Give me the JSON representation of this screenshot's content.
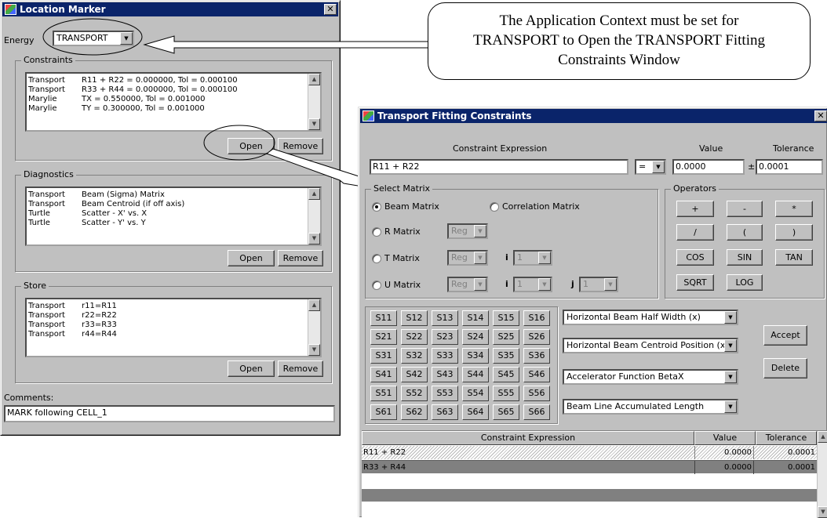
{
  "location_marker": {
    "title": "Location Marker",
    "close": "✕",
    "energy_label": "Energy",
    "energy_value": "TRANSPORT",
    "constraints": {
      "label": "Constraints",
      "rows": [
        {
          "code": "Transport",
          "text": "R11 + R22 = 0.000000, Tol = 0.000100"
        },
        {
          "code": "Transport",
          "text": "R33 + R44 = 0.000000, Tol = 0.000100"
        },
        {
          "code": "Marylie",
          "text": "TX = 0.550000, Tol = 0.001000"
        },
        {
          "code": "Marylie",
          "text": "TY = 0.300000, Tol = 0.001000"
        }
      ]
    },
    "diagnostics": {
      "label": "Diagnostics",
      "rows": [
        {
          "code": "Transport",
          "text": "Beam (Sigma) Matrix"
        },
        {
          "code": "Transport",
          "text": "Beam Centroid (if off axis)"
        },
        {
          "code": "Turtle",
          "text": "Scatter - X' vs. X"
        },
        {
          "code": "Turtle",
          "text": "Scatter - Y' vs. Y"
        }
      ]
    },
    "store": {
      "label": "Store",
      "rows": [
        {
          "code": "Transport",
          "text": "r11=R11"
        },
        {
          "code": "Transport",
          "text": "r22=R22"
        },
        {
          "code": "Transport",
          "text": "r33=R33"
        },
        {
          "code": "Transport",
          "text": "r44=R44"
        }
      ]
    },
    "open_label": "Open",
    "remove_label": "Remove",
    "comments_label": "Comments:",
    "comments_value": "MARK  following CELL_1"
  },
  "callout": "The Application Context must be set for TRANSPORT to Open the TRANSPORT Fitting Constraints Window",
  "tfc": {
    "title": "Transport Fitting Constraints",
    "close": "✕",
    "expr_header": "Constraint Expression",
    "value_header": "Value",
    "tol_header": "Tolerance",
    "expr_value": "R11 + R22",
    "op_value": "=",
    "value_value": "0.0000",
    "pm": "±",
    "tol_value": "0.0001",
    "select_matrix": "Select Matrix",
    "beam_matrix": "Beam Matrix",
    "correlation_matrix": "Correlation Matrix",
    "r_matrix": "R Matrix",
    "t_matrix": "T Matrix",
    "u_matrix": "U Matrix",
    "reg": "Reg",
    "i_label": "i",
    "j_label": "j",
    "one": "1",
    "operators_label": "Operators",
    "operators": [
      "+",
      "-",
      "*",
      "/",
      "(",
      ")",
      "COS",
      "SIN",
      "TAN",
      "SQRT",
      "LOG"
    ],
    "s_cells": [
      [
        "S11",
        "S12",
        "S13",
        "S14",
        "S15",
        "S16"
      ],
      [
        "S21",
        "S22",
        "S23",
        "S24",
        "S25",
        "S26"
      ],
      [
        "S31",
        "S32",
        "S33",
        "S34",
        "S35",
        "S36"
      ],
      [
        "S41",
        "S42",
        "S43",
        "S44",
        "S45",
        "S46"
      ],
      [
        "S51",
        "S52",
        "S53",
        "S54",
        "S55",
        "S56"
      ],
      [
        "S61",
        "S62",
        "S63",
        "S64",
        "S65",
        "S66"
      ]
    ],
    "functions": [
      "Horizontal Beam Half Width (x)",
      "Horizontal Beam Centroid Position (x)",
      "Accelerator Function BetaX",
      "Beam Line Accumulated Length"
    ],
    "accept": "Accept",
    "delete": "Delete",
    "table": {
      "headers": [
        "Constraint Expression",
        "Value",
        "Tolerance"
      ],
      "rows": [
        {
          "expr": "R11 + R22",
          "value": "0.0000",
          "tol": "0.0001"
        },
        {
          "expr": "R33 + R44",
          "value": "0.0000",
          "tol": "0.0001"
        }
      ]
    }
  },
  "colors": {
    "titlebar": "#0a246a",
    "face": "#c0c0c0",
    "selected_row": "#808080"
  }
}
